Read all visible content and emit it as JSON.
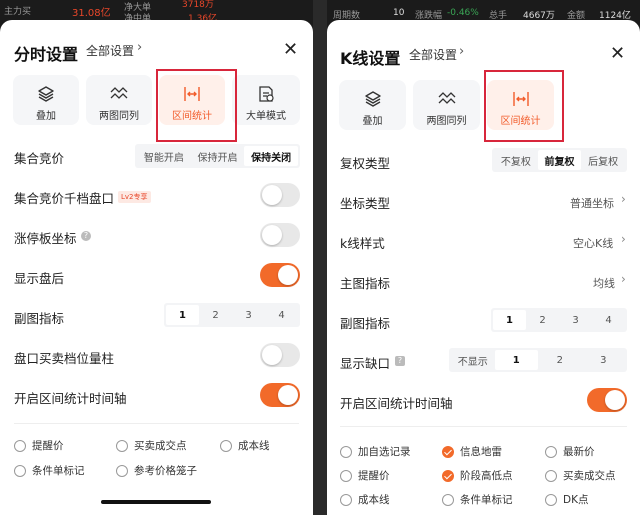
{
  "left": {
    "bg": {
      "l1": "主力买",
      "v1": "31.08亿",
      "l2": "净大单",
      "v2": "3718万",
      "l3": "净中单",
      "v3": "1.36亿"
    },
    "title": "分时设置",
    "all_settings": "全部设置",
    "tiles": [
      {
        "label": "叠加",
        "icon": "layers-icon"
      },
      {
        "label": "两图同列",
        "icon": "wave-lines-icon"
      },
      {
        "label": "区间统计",
        "icon": "interval-stats-icon"
      },
      {
        "label": "大单模式",
        "icon": "big-order-icon"
      }
    ],
    "rows": {
      "auction": "集合竞价",
      "auction_opts": [
        "智能开启",
        "保持开启",
        "保持关闭"
      ],
      "auction_depth": "集合竞价千档盘口",
      "lv2_badge": "Lv2专享",
      "limit_axis": "涨停板坐标",
      "after_hours": "显示盘后",
      "sub_indicator": "副图指标",
      "sub_opts": [
        "1",
        "2",
        "3",
        "4"
      ],
      "bid_ask_bar": "盘口买卖档位量柱",
      "interval_axis": "开启区间统计时间轴"
    },
    "checks": [
      {
        "label": "提醒价",
        "on": false
      },
      {
        "label": "买卖成交点",
        "on": false
      },
      {
        "label": "成本线",
        "on": false
      },
      {
        "label": "条件单标记",
        "on": false
      },
      {
        "label": "参考价格笼子",
        "on": false
      }
    ]
  },
  "right": {
    "bg": {
      "l1": "周期数",
      "v1": "10",
      "l2": "涨跌幅",
      "v2": "-0.46%",
      "l3": "总手",
      "v3": "4667万",
      "l4": "金额",
      "v4": "1124亿"
    },
    "title": "K线设置",
    "all_settings": "全部设置",
    "tiles": [
      {
        "label": "叠加",
        "icon": "layers-icon"
      },
      {
        "label": "两图同列",
        "icon": "wave-lines-icon"
      },
      {
        "label": "区间统计",
        "icon": "interval-stats-icon"
      }
    ],
    "rows": {
      "adjust": "复权类型",
      "adjust_opts": [
        "不复权",
        "前复权",
        "后复权"
      ],
      "axis_type": "坐标类型",
      "axis_value": "普通坐标",
      "kline_style": "k线样式",
      "kline_value": "空心K线",
      "main_indicator": "主图指标",
      "main_value": "均线",
      "sub_indicator": "副图指标",
      "sub_opts": [
        "1",
        "2",
        "3",
        "4"
      ],
      "gap": "显示缺口",
      "gap_opts": [
        "不显示",
        "1",
        "2",
        "3"
      ],
      "interval_axis": "开启区间统计时间轴"
    },
    "checks": [
      {
        "label": "加自选记录",
        "on": false
      },
      {
        "label": "信息地雷",
        "on": true
      },
      {
        "label": "最新价",
        "on": false
      },
      {
        "label": "提醒价",
        "on": false
      },
      {
        "label": "阶段高低点",
        "on": true
      },
      {
        "label": "买卖成交点",
        "on": false
      },
      {
        "label": "成本线",
        "on": false
      },
      {
        "label": "条件单标记",
        "on": false
      },
      {
        "label": "DK点",
        "on": false
      }
    ]
  },
  "colors": {
    "accent": "#f26a2a",
    "highlight_box": "#d8263b",
    "red_text": "#e8472a"
  }
}
